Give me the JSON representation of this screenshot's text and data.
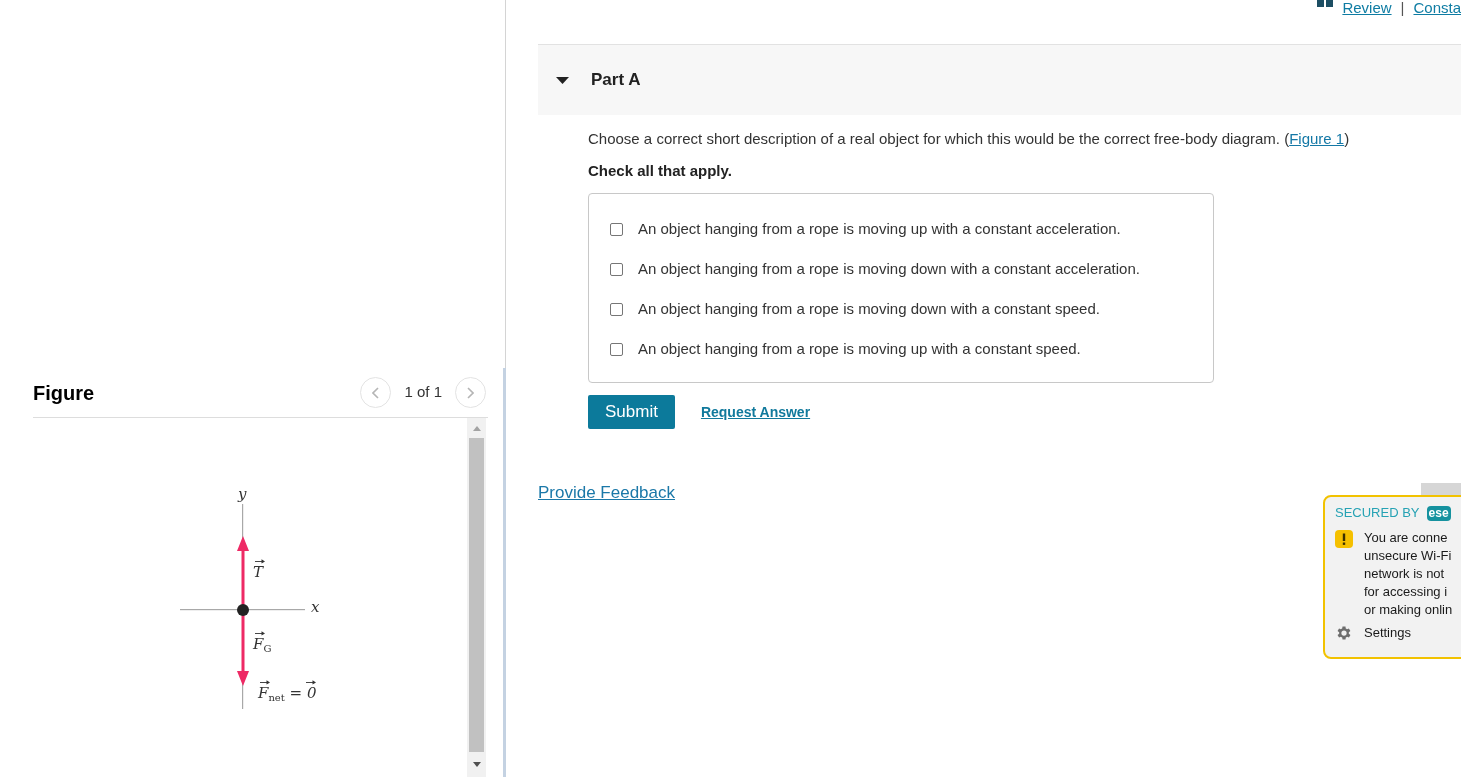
{
  "top_links": {
    "items": [
      "Review",
      "Consta"
    ],
    "separator": "|"
  },
  "figure_panel": {
    "title": "Figure",
    "pager": "1 of 1",
    "diagram": {
      "axis_labels": [
        "y",
        "x"
      ],
      "force_labels": [
        "T",
        "F$_{G}$"
      ],
      "net_label": "F$_{net}$ = 0"
    }
  },
  "part": {
    "title": "Part A",
    "expanded": true,
    "question": {
      "text": "Choose a correct short description of a real object for which this would be the correct free-body diagram. (",
      "link": "Figure 1",
      "text_after": ")"
    },
    "instruction": "Check all that apply.",
    "options": [
      {
        "label": "An object hanging from a rope is moving up with a constant acceleration.",
        "checked": false
      },
      {
        "label": "An object hanging from a rope is moving down with a constant acceleration.",
        "checked": false
      },
      {
        "label": "An object hanging from a rope is moving down with a constant speed.",
        "checked": false
      },
      {
        "label": "An object hanging from a rope is moving up with a constant speed.",
        "checked": false
      }
    ],
    "submit": "Submit",
    "request_answer": "Request Answer"
  },
  "feedback_link": "Provide Feedback",
  "security_popup": {
    "secured_by": "SECURED BY",
    "logo": "ese",
    "message_lines": [
      "You are conne",
      "unsecure Wi-Fi",
      "network is not",
      "for accessing i",
      "or making onlin"
    ],
    "settings": "Settings"
  }
}
